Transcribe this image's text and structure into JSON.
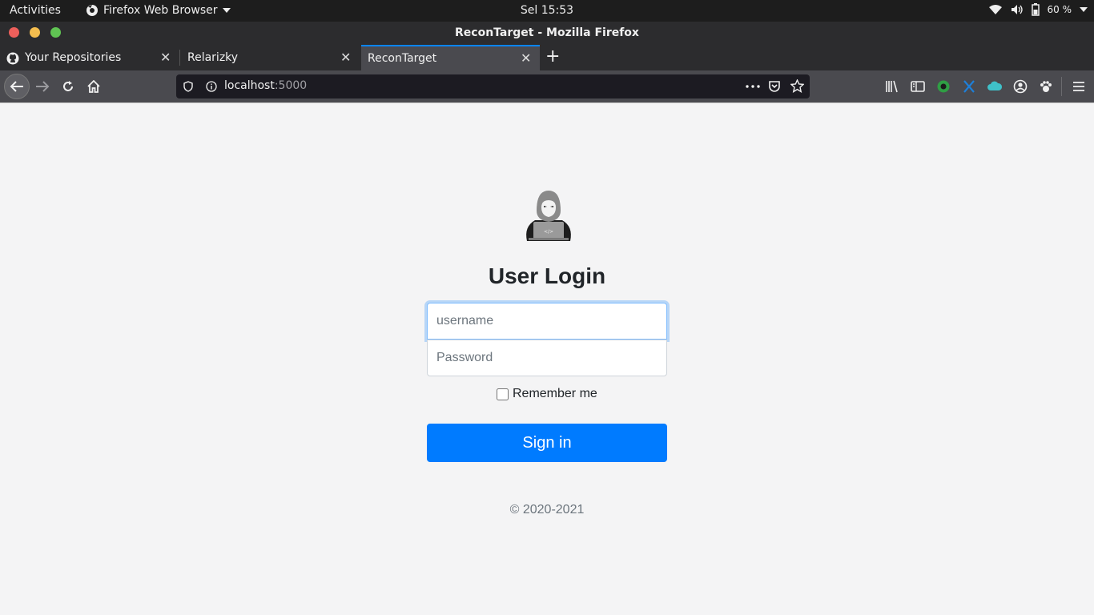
{
  "system": {
    "activities": "Activities",
    "app_menu": "Firefox Web Browser",
    "clock": "Sel 15:53",
    "battery": "60 %"
  },
  "window": {
    "title": "ReconTarget - Mozilla Firefox"
  },
  "tabs": [
    {
      "label": "Your Repositories",
      "icon": "github-icon"
    },
    {
      "label": "Relarizky"
    },
    {
      "label": "ReconTarget",
      "active": true
    }
  ],
  "urlbar": {
    "host": "localhost",
    "port": ":5000"
  },
  "login": {
    "title": "User Login",
    "username_placeholder": "username",
    "password_placeholder": "Password",
    "remember_label": "Remember me",
    "signin_label": "Sign in",
    "copyright": "© 2020-2021"
  },
  "colors": {
    "primary": "#007bff",
    "focus_ring": "#80bdff",
    "tab_accent": "#0a84ff"
  }
}
